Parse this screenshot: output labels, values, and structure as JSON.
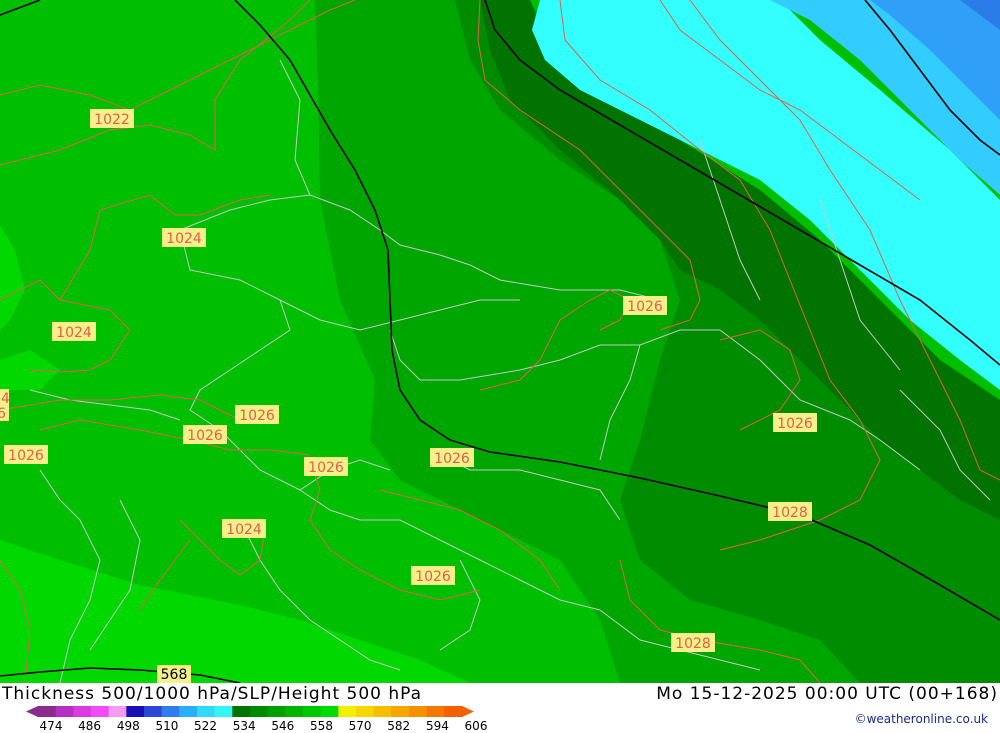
{
  "title": "Thickness 500/1000 hPa/SLP/Height 500 hPa",
  "datetime": "Mo 15-12-2025 00:00 UTC (00+168)",
  "credit": "©weatheronline.co.uk",
  "isobar_labels": [
    "1022",
    "1024",
    "1024",
    "1026",
    "1026",
    "1026",
    "1026",
    "1026",
    "1026",
    "1026",
    "1026",
    "1028",
    "1028",
    "1024",
    "1026"
  ],
  "edge_labels": [
    "4",
    "6"
  ],
  "height_label": "568",
  "legend": {
    "values": [
      "474",
      "486",
      "498",
      "510",
      "522",
      "534",
      "546",
      "558",
      "570",
      "582",
      "594",
      "606"
    ],
    "colors": [
      "#8a2c8f",
      "#b62fc3",
      "#d93be0",
      "#f04cf5",
      "#f49bf6",
      "#1a0fb5",
      "#2a47d6",
      "#2f7cf0",
      "#29aef9",
      "#33d8fa",
      "#36f5f7",
      "#007300",
      "#008a00",
      "#00a000",
      "#00b400",
      "#00c800",
      "#00dc00",
      "#f0f000",
      "#f5d800",
      "#f7bd00",
      "#f6a600",
      "#f59000",
      "#f47800",
      "#f26000"
    ]
  },
  "map_colors": {
    "g1": "#00d800",
    "g2": "#00bf00",
    "g3": "#00a600",
    "g4": "#008c00",
    "g5": "#007300",
    "cyan": "#33ffff",
    "blue1": "#33ccff",
    "blue2": "#2f9ff7",
    "isobar": "#e0604a",
    "border": "#c7c7c7",
    "height_line": "#000000"
  }
}
